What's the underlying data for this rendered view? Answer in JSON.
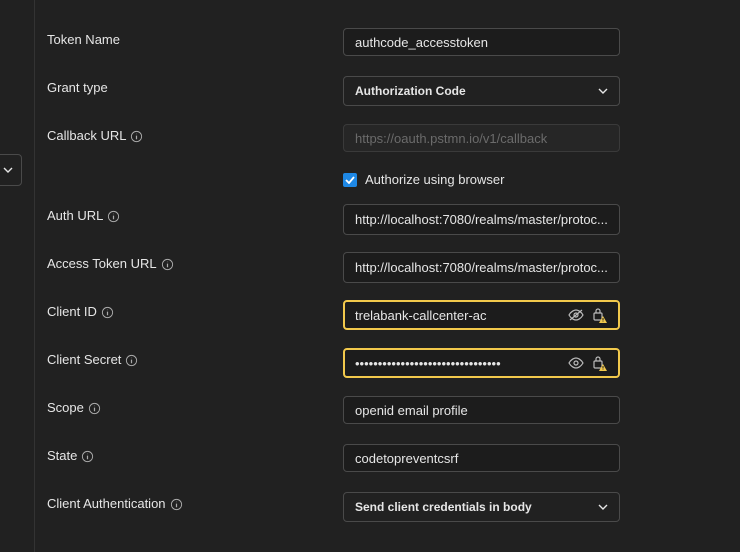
{
  "form": {
    "token_name": {
      "label": "Token Name",
      "value": "authcode_accesstoken"
    },
    "grant_type": {
      "label": "Grant type",
      "value": "Authorization Code"
    },
    "callback_url": {
      "label": "Callback URL",
      "placeholder": "https://oauth.pstmn.io/v1/callback"
    },
    "authorize_browser": {
      "label": "Authorize using browser",
      "checked": true
    },
    "auth_url": {
      "label": "Auth URL",
      "value": "http://localhost:7080/realms/master/protoc..."
    },
    "access_token_url": {
      "label": "Access Token URL",
      "value": "http://localhost:7080/realms/master/protoc..."
    },
    "client_id": {
      "label": "Client ID",
      "value": "trelabank-callcenter-ac"
    },
    "client_secret": {
      "label": "Client Secret",
      "value": "••••••••••••••••••••••••••••••••"
    },
    "scope": {
      "label": "Scope",
      "value": "openid email profile"
    },
    "state": {
      "label": "State",
      "value": "codetopreventcsrf"
    },
    "client_auth": {
      "label": "Client Authentication",
      "value": "Send client credentials in body"
    }
  },
  "colors": {
    "warning": "#f2c94c",
    "accent": "#1e88e5"
  }
}
